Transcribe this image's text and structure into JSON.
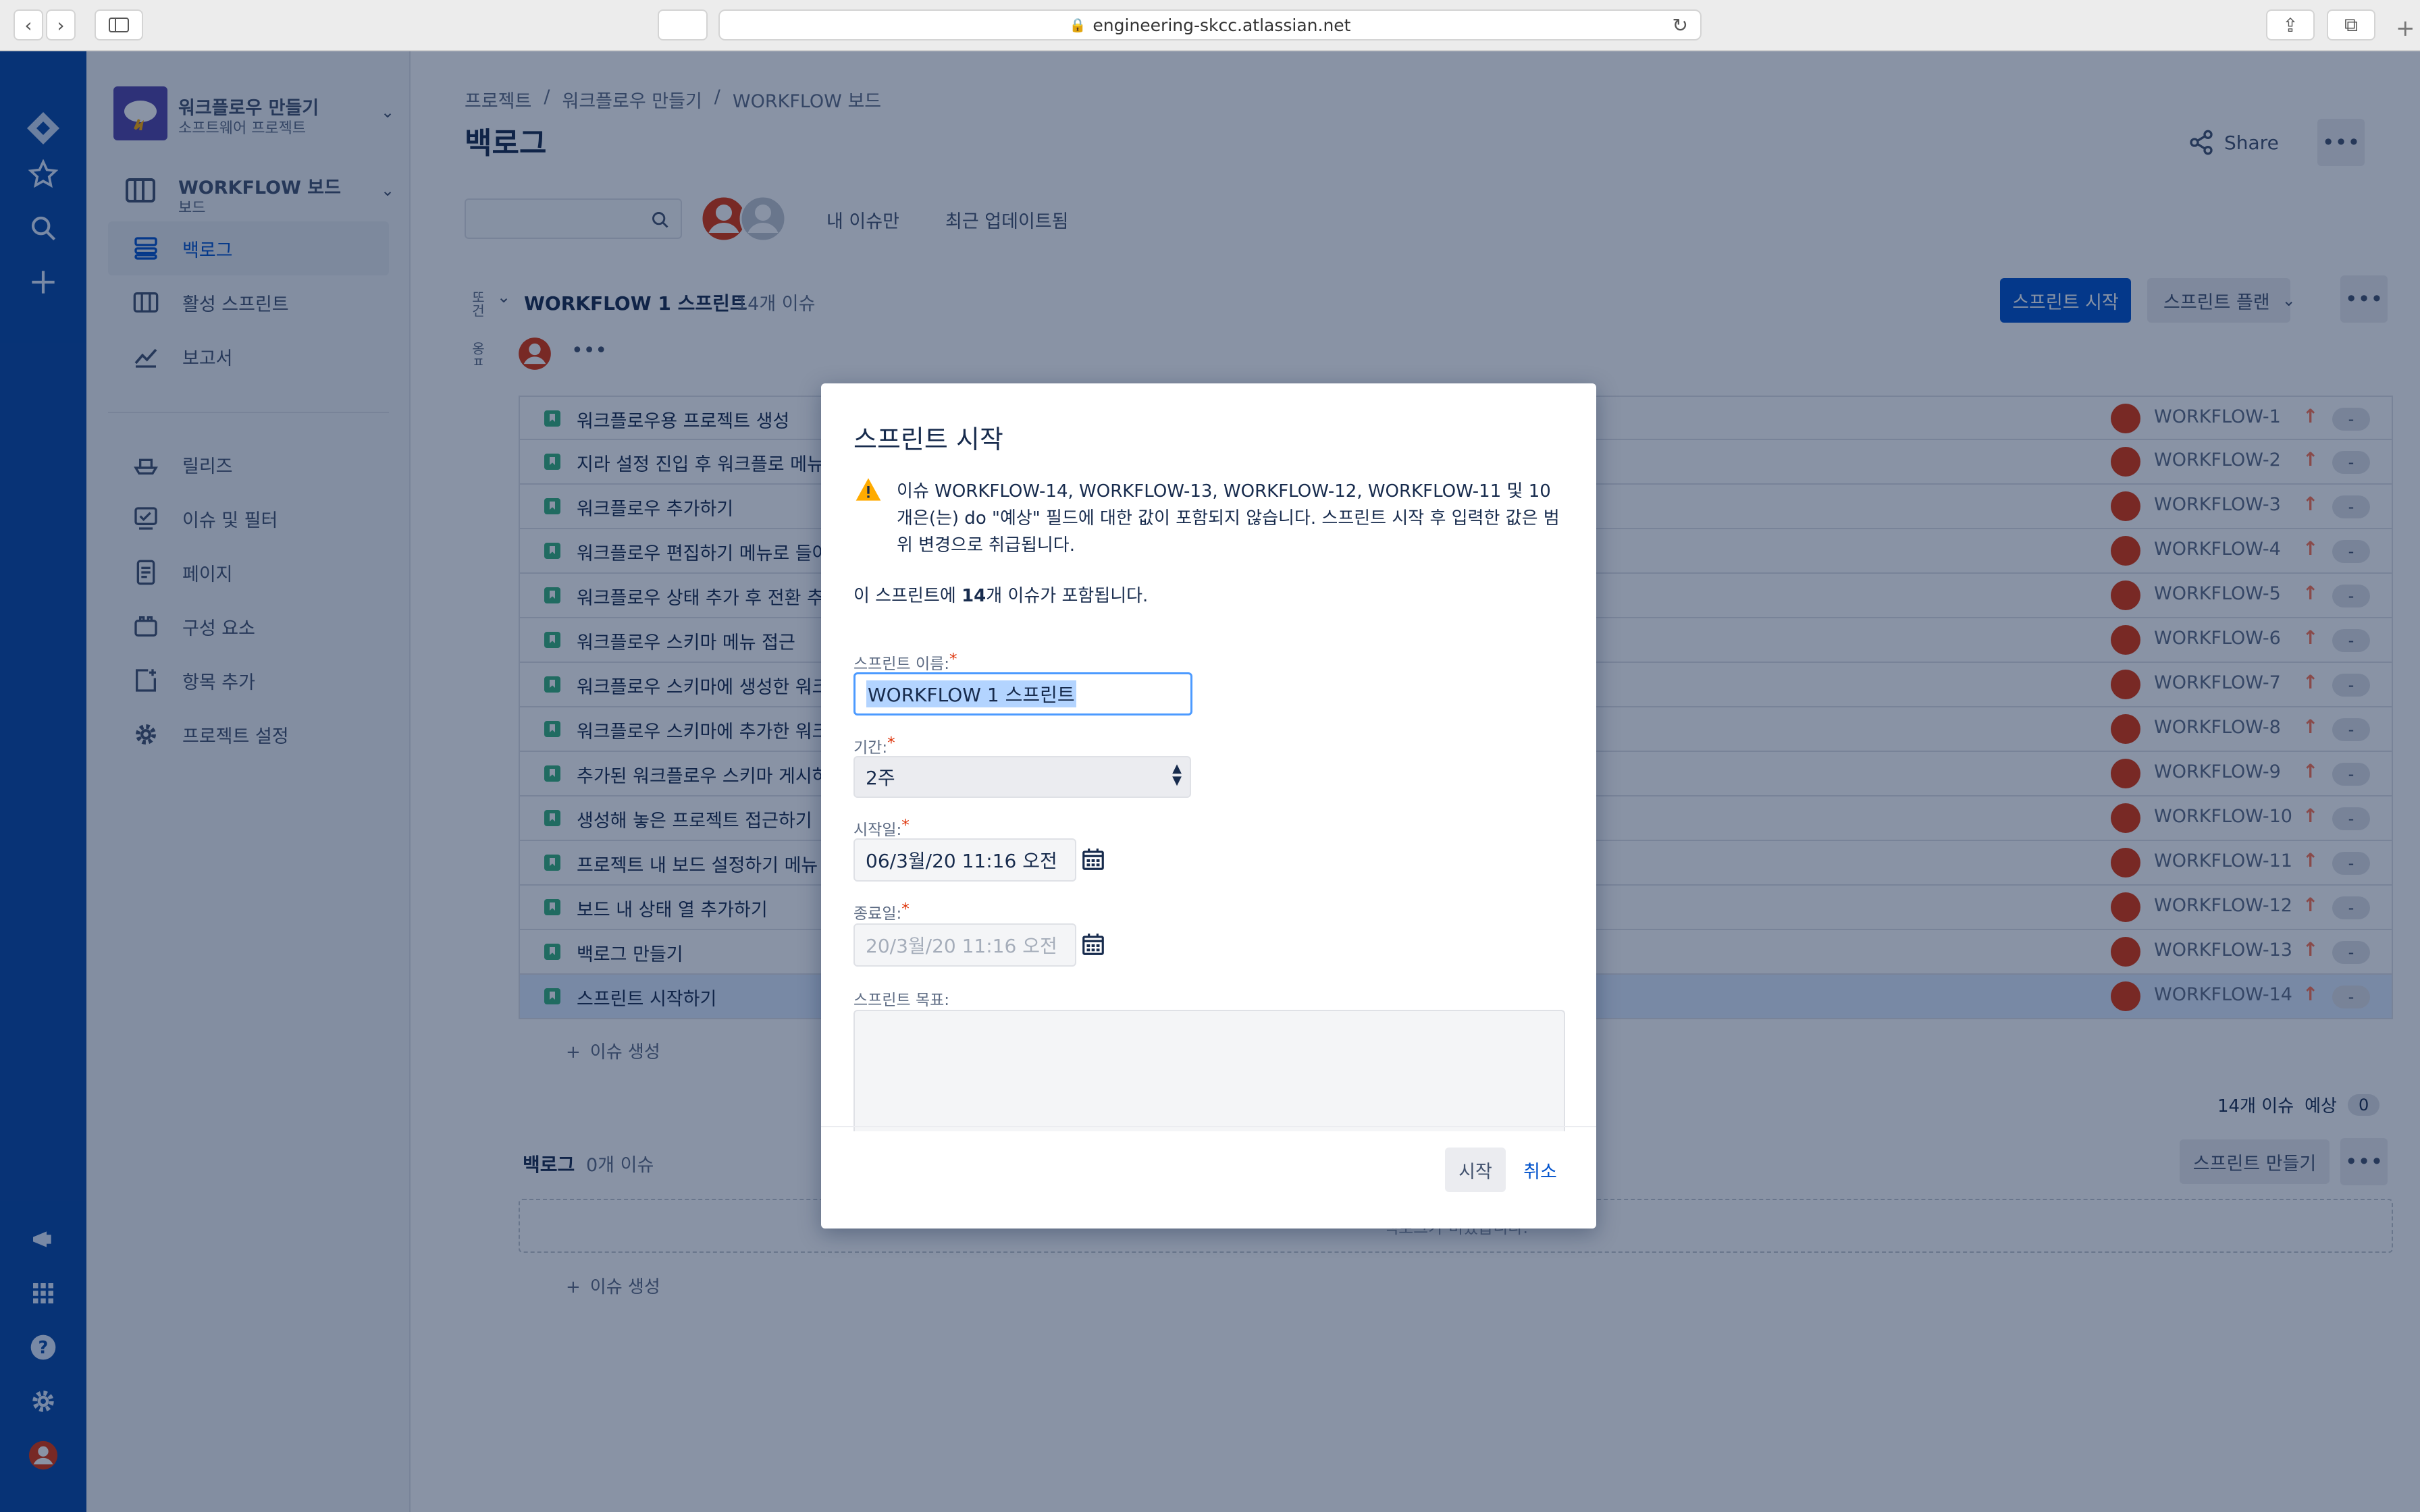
{
  "browser": {
    "url": "engineering-skcc.atlassian.net"
  },
  "sidebar": {
    "project_name": "워크플로우 만들기",
    "project_type": "소프트웨어 프로젝트",
    "board_name": "WORKFLOW 보드",
    "board_type": "보드",
    "items": [
      {
        "label": "백로그",
        "icon": "backlog-icon"
      },
      {
        "label": "활성 스프린트",
        "icon": "board-icon"
      },
      {
        "label": "보고서",
        "icon": "report-icon"
      },
      {
        "label": "릴리즈",
        "icon": "ship-icon"
      },
      {
        "label": "이슈 및 필터",
        "icon": "filter-icon"
      },
      {
        "label": "페이지",
        "icon": "page-icon"
      },
      {
        "label": "구성 요소",
        "icon": "component-icon"
      },
      {
        "label": "항목 추가",
        "icon": "add-item-icon"
      },
      {
        "label": "프로젝트 설정",
        "icon": "gear-icon"
      }
    ]
  },
  "header": {
    "breadcrumbs": [
      "프로젝트",
      "워크플로우 만들기",
      "WORKFLOW 보드"
    ],
    "title": "백로그",
    "share_label": "Share",
    "filter_mine": "내 이슈만",
    "filter_recent": "최근 업데이트됨"
  },
  "sprint": {
    "name": "WORKFLOW 1 스프린트",
    "count": "14개 이슈",
    "side_label_a": "또건",
    "side_label_b": "옹ㅍ",
    "start_button": "스프린트 시작",
    "plan_button": "스프린트 플랜",
    "create_issue": "이슈 생성",
    "footer_count": "14개 이슈",
    "footer_estimate_label": "예상",
    "footer_estimate_value": "0",
    "issues": [
      {
        "summary": "워크플로우용 프로젝트 생성",
        "key": "WORKFLOW-1"
      },
      {
        "summary": "지라 설정 진입 후 워크플로 메뉴",
        "key": "WORKFLOW-2"
      },
      {
        "summary": "워크플로우 추가하기",
        "key": "WORKFLOW-3"
      },
      {
        "summary": "워크플로우 편집하기 메뉴로 들어",
        "key": "WORKFLOW-4"
      },
      {
        "summary": "워크플로우 상태 추가 후 전환 추가",
        "key": "WORKFLOW-5"
      },
      {
        "summary": "워크플로우 스키마 메뉴 접근",
        "key": "WORKFLOW-6"
      },
      {
        "summary": "워크플로우 스키마에 생성한 워크",
        "key": "WORKFLOW-7"
      },
      {
        "summary": "워크플로우 스키마에 추가한 워크",
        "key": "WORKFLOW-8"
      },
      {
        "summary": "추가된 워크플로우 스키마 게시하",
        "key": "WORKFLOW-9"
      },
      {
        "summary": "생성해 놓은 프로젝트 접근하기",
        "key": "WORKFLOW-10"
      },
      {
        "summary": "프로젝트 내 보드 설정하기 메뉴 접",
        "key": "WORKFLOW-11"
      },
      {
        "summary": "보드 내 상태 열 추가하기",
        "key": "WORKFLOW-12"
      },
      {
        "summary": "백로그 만들기",
        "key": "WORKFLOW-13"
      },
      {
        "summary": "스프린트 시작하기",
        "key": "WORKFLOW-14"
      }
    ],
    "estimate_dash": "-"
  },
  "backlog": {
    "title": "백로그",
    "count": "0개 이슈",
    "create_sprint": "스프린트 만들기",
    "empty_text": "백로그가 비었습니다.",
    "create_issue": "이슈 생성"
  },
  "dialog": {
    "title": "스프린트 시작",
    "warning": "이슈 WORKFLOW-14, WORKFLOW-13, WORKFLOW-12, WORKFLOW-11 및 10 개은(는) do \"예상\" 필드에 대한 값이 포함되지 않습니다. 스프린트 시작 후 입력한 값은 범위 변경으로 취급됩니다.",
    "info_prefix": "이 스프린트에 ",
    "info_count": "14",
    "info_suffix": "개 이슈가 포함됩니다.",
    "name_label": "스프린트 이름:",
    "name_value": "WORKFLOW 1 스프린트",
    "duration_label": "기간:",
    "duration_value": "2주",
    "start_label": "시작일:",
    "start_value": "06/3월/20 11:16 오전",
    "end_label": "종료일:",
    "end_value": "20/3월/20 11:16 오전",
    "goal_label": "스프린트 목표:",
    "start_button": "시작",
    "cancel_button": "취소",
    "required_mark": "*"
  },
  "colors": {
    "global_nav": "#0747a6",
    "primary": "#0052cc",
    "story": "#36b37e",
    "avatar": "#de350b",
    "priority": "#ff7452"
  }
}
